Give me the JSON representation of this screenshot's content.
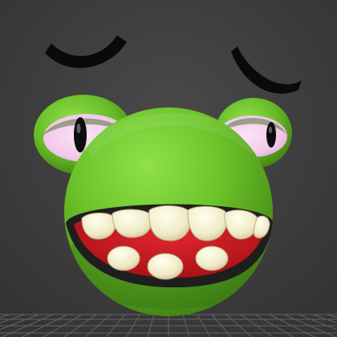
{
  "viewport": {
    "background": "#3a3a3a",
    "grid_color": "#6a6a6a"
  },
  "character": {
    "skin_color": "#6cc42a",
    "skin_shadow_color": "#3f7f12",
    "mouth_outer_color": "#1e1e1e",
    "mouth_inner_color": "#c8161d",
    "tooth_color": "#f2efcf",
    "eye_white_color": "#f2c9ea",
    "pupil_color": "#0d0d0d",
    "eyebrow_color": "#0a0a0a",
    "upper_teeth_count": 6,
    "lower_teeth_count": 3
  }
}
